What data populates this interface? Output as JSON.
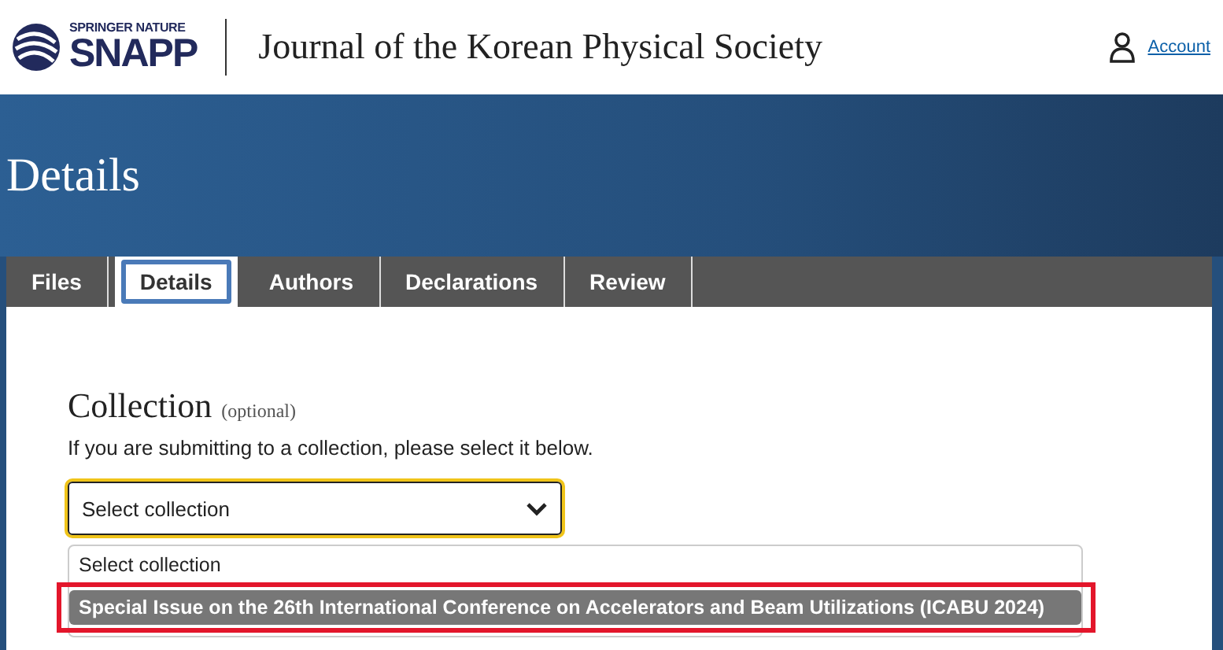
{
  "header": {
    "brand_small": "SPRINGER NATURE",
    "brand": "SNAPP",
    "journal": "Journal of the Korean Physical Society",
    "account_link": "Account"
  },
  "banner": {
    "title": "Details"
  },
  "tabs": [
    {
      "label": "Files",
      "selected": false
    },
    {
      "label": "Details",
      "selected": true
    },
    {
      "label": "Authors",
      "selected": false
    },
    {
      "label": "Declarations",
      "selected": false
    },
    {
      "label": "Review",
      "selected": false
    }
  ],
  "collection": {
    "heading": "Collection",
    "hint": "(optional)",
    "description": "If you are submitting to a collection, please select it below.",
    "select_value": "Select collection",
    "options": [
      {
        "label": "Select collection",
        "selected": false
      },
      {
        "label": "Special Issue on the 26th International Conference on Accelerators and Beam Utilizations (ICABU 2024)",
        "selected": true
      }
    ]
  }
}
